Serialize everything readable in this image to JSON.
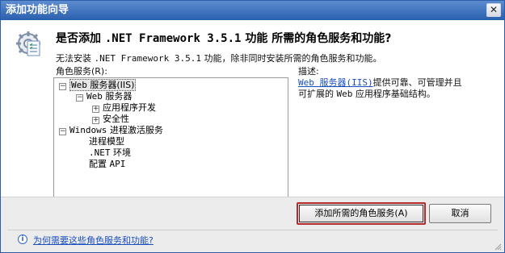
{
  "window": {
    "title": "添加功能向导",
    "close_symbol": "✕"
  },
  "header": {
    "icon_name": "wizard-gear-icon",
    "question_prefix": "是否添加 ",
    "question_net": ".NET Framework 3.5.1",
    "question_suffix": " 功能 所需的角色服务和功能?"
  },
  "description": {
    "prefix": "无法安装 ",
    "net": ".NET Framework 3.5.1",
    "suffix": " 功能，除非同时安装所需的角色服务和功能。"
  },
  "roles": {
    "label": "角色服务(R):",
    "tree": [
      {
        "expander": "−",
        "mono": "Web",
        "label": " 服务器(IIS)",
        "selected": true
      },
      {
        "expander": "−",
        "mono": "Web",
        "label": " 服务器"
      },
      {
        "expander": "+",
        "label": "应用程序开发"
      },
      {
        "expander": "+",
        "label": "安全性"
      },
      {
        "expander": "−",
        "mono": "Windows",
        "label": " 进程激活服务"
      },
      {
        "label": "进程模型"
      },
      {
        "mono": ".NET",
        "label": " 环境"
      },
      {
        "label": "配置 ",
        "mono_after": "API"
      }
    ]
  },
  "details": {
    "title": "描述:",
    "link_text": "Web 服务器(IIS)",
    "line1_after_link": "提供可靠、可管理并且",
    "line2_prefix": "可扩展的 ",
    "line2_mono": "Web",
    "line2_suffix": " 应用程序基础结构。"
  },
  "buttons": {
    "add": "添加所需的角色服务(A)",
    "cancel": "取消"
  },
  "help": {
    "icon_name": "info-icon",
    "link": "为何需要这些角色服务和功能?"
  },
  "colors": {
    "title_bar": "#2a5fae",
    "link": "#1a4fbf",
    "focus_border": "#b52a2a"
  }
}
